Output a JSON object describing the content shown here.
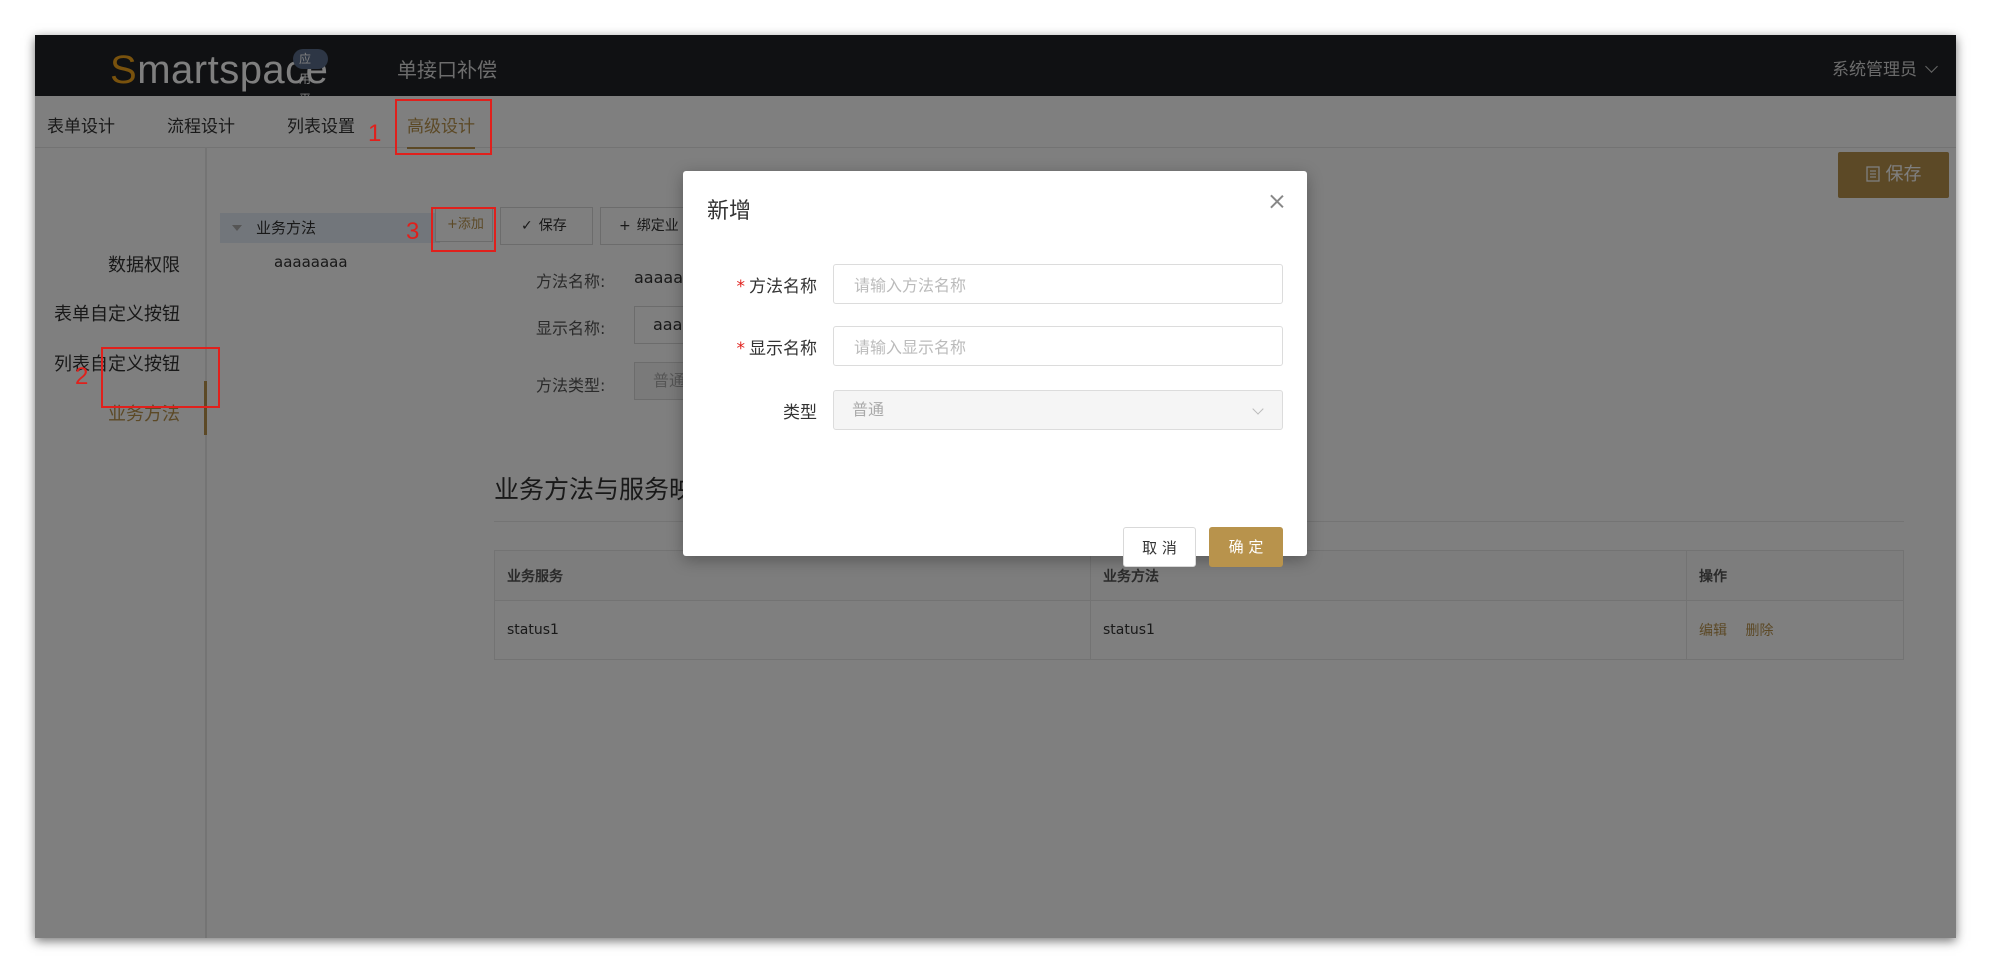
{
  "app": {
    "logo_first": "S",
    "logo_rest": "martspace",
    "logo_badge": "应用平台",
    "title": "单接口补偿",
    "user_menu": "系统管理员"
  },
  "tabs": [
    {
      "label": "表单设计"
    },
    {
      "label": "流程设计"
    },
    {
      "label": "列表设置"
    },
    {
      "label": "高级设计"
    }
  ],
  "toolbar": {
    "save_label": "保存"
  },
  "sidenav": [
    {
      "label": "数据权限"
    },
    {
      "label": "表单自定义按钮"
    },
    {
      "label": "列表自定义按钮"
    },
    {
      "label": "业务方法"
    }
  ],
  "tree": {
    "root": "业务方法",
    "child": "aaaaaaaa",
    "add_label": "+添加",
    "save_label": "保存",
    "bind_label": "绑定业"
  },
  "detail": {
    "method_name_label": "方法名称:",
    "method_name_value": "aaaaaa",
    "display_name_label": "显示名称:",
    "display_name_value": "aaa",
    "method_type_label": "方法类型:",
    "method_type_value": "普通"
  },
  "section": {
    "title": "业务方法与服务映"
  },
  "table": {
    "headers": [
      "业务服务",
      "业务方法",
      "操作"
    ],
    "rows": [
      {
        "service": "status1",
        "method": "status1",
        "edit": "编辑",
        "delete": "删除"
      }
    ]
  },
  "annotations": [
    "1",
    "2",
    "3"
  ],
  "modal": {
    "title": "新增",
    "fields": [
      {
        "label": "方法名称",
        "required": "*",
        "placeholder": "请输入方法名称"
      },
      {
        "label": "显示名称",
        "required": "*",
        "placeholder": "请输入显示名称"
      },
      {
        "label": "类型",
        "value": "普通"
      }
    ],
    "cancel_label": "取 消",
    "confirm_label": "确 定"
  },
  "colors": {
    "accent": "#b8934c",
    "topbar": "#202327",
    "annotation": "#e0201c"
  }
}
